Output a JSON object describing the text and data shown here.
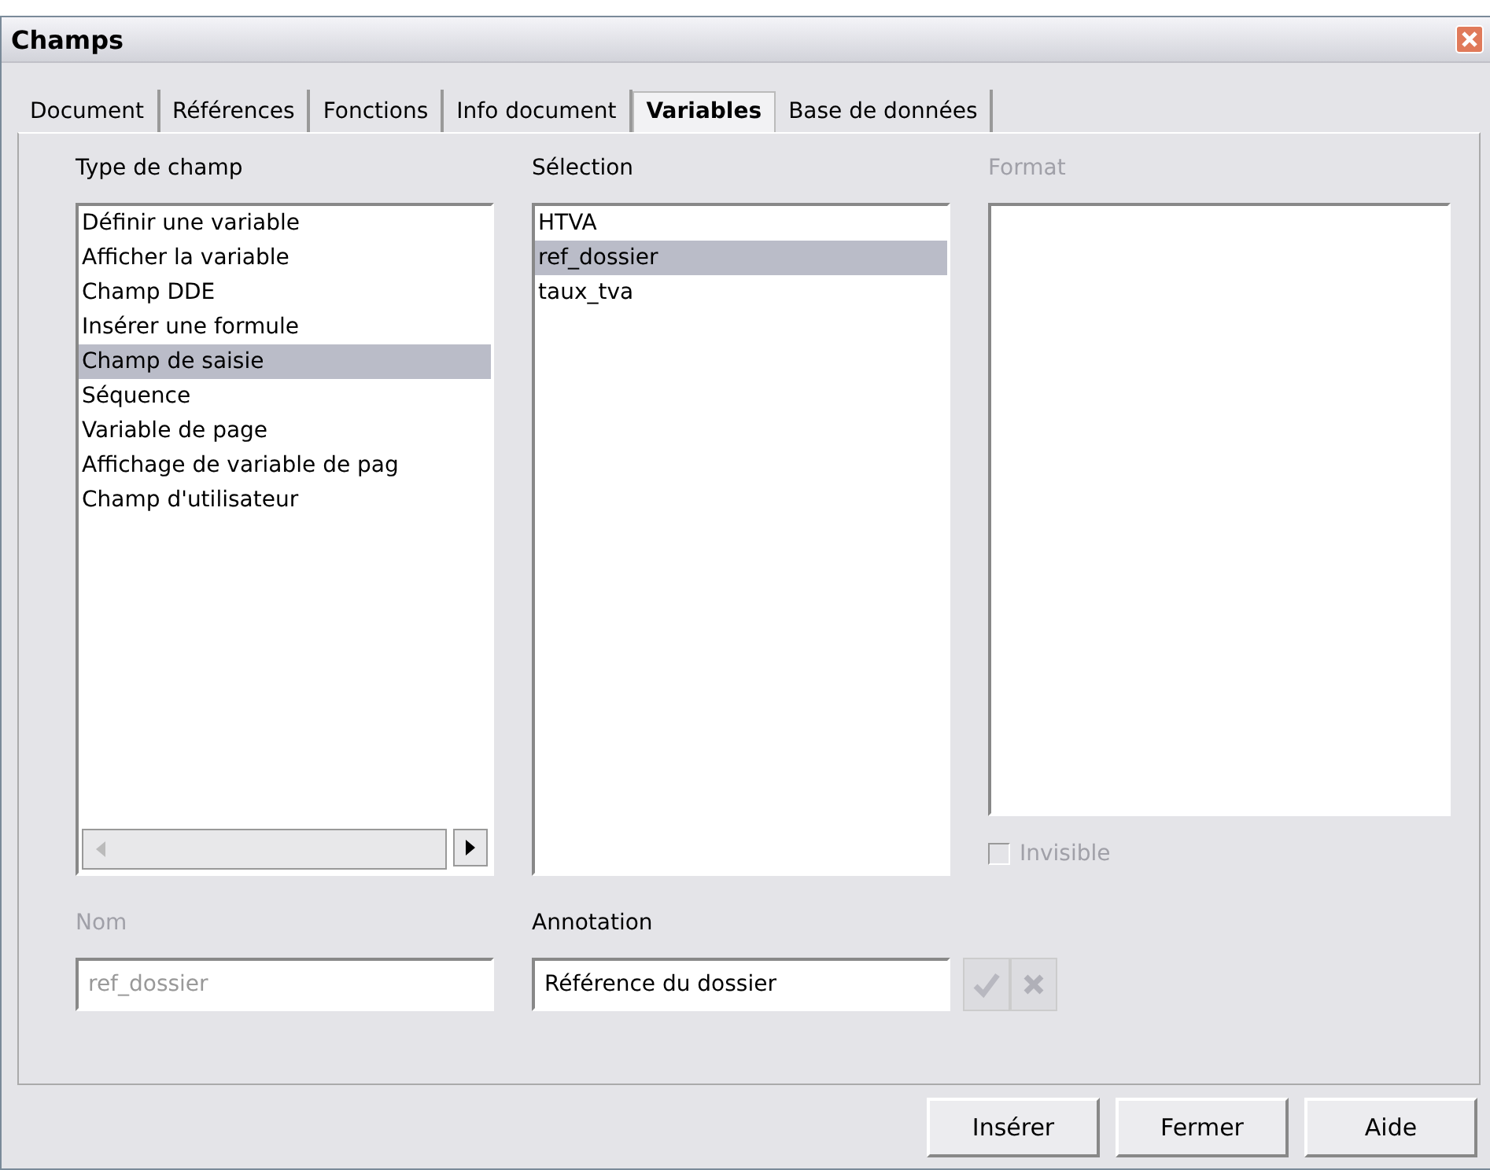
{
  "window": {
    "title": "Champs"
  },
  "tabs": [
    {
      "label": "Document",
      "selected": false
    },
    {
      "label": "Références",
      "selected": false
    },
    {
      "label": "Fonctions",
      "selected": false
    },
    {
      "label": "Info document",
      "selected": false
    },
    {
      "label": "Variables",
      "selected": true
    },
    {
      "label": "Base de données",
      "selected": false
    }
  ],
  "type_de_champ": {
    "label": "Type de champ",
    "items": [
      {
        "label": "Définir une variable",
        "selected": false
      },
      {
        "label": "Afficher la variable",
        "selected": false
      },
      {
        "label": "Champ DDE",
        "selected": false
      },
      {
        "label": "Insérer une formule",
        "selected": false
      },
      {
        "label": "Champ de saisie",
        "selected": true
      },
      {
        "label": "Séquence",
        "selected": false
      },
      {
        "label": "Variable de page",
        "selected": false
      },
      {
        "label": "Affichage de variable de pag",
        "selected": false
      },
      {
        "label": "Champ d'utilisateur",
        "selected": false
      }
    ]
  },
  "selection": {
    "label": "Sélection",
    "items": [
      {
        "label": "HTVA",
        "selected": false
      },
      {
        "label": "ref_dossier",
        "selected": true
      },
      {
        "label": "taux_tva",
        "selected": false
      }
    ]
  },
  "format": {
    "label": "Format",
    "disabled": true
  },
  "invisible": {
    "label": "Invisible",
    "checked": false,
    "disabled": true
  },
  "nom": {
    "label": "Nom",
    "value": "ref_dossier",
    "disabled": true
  },
  "annotation": {
    "label": "Annotation",
    "value": "Référence du dossier",
    "disabled": false
  },
  "buttons": [
    "Insérer",
    "Fermer",
    "Aide"
  ]
}
